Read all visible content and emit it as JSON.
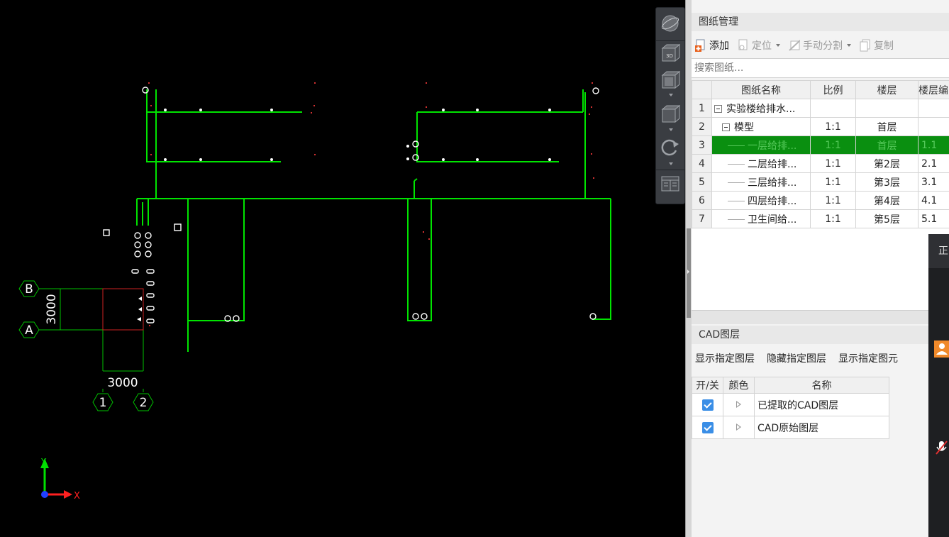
{
  "cad": {
    "axis_labels": {
      "row_b": "B",
      "row_a": "A",
      "col_1": "1",
      "col_2": "2"
    },
    "dims": {
      "horizontal": "3000",
      "vertical": "3000"
    },
    "ucs": {
      "y": "Y",
      "x": "X"
    }
  },
  "nav_toolbar": {
    "buttons": [
      "orbit-icon",
      "view-3d-icon",
      "view-top-icon",
      "view-iso-icon",
      "rotate-icon",
      "layout-icon"
    ],
    "view_3d_label": "3D"
  },
  "drawing_manager": {
    "title": "图纸管理",
    "toolbar": {
      "add": "添加",
      "locate": "定位",
      "manual_split": "手动分割",
      "copy": "复制"
    },
    "search_placeholder": "搜索图纸...",
    "columns": {
      "num": "",
      "name": "图纸名称",
      "scale": "比例",
      "floor": "楼层",
      "floor_code": "楼层编"
    },
    "rows": [
      {
        "num": "1",
        "name": "实验楼给排水...",
        "scale": "",
        "floor": "",
        "code": ""
      },
      {
        "num": "2",
        "name": "模型",
        "scale": "1:1",
        "floor": "首层",
        "code": ""
      },
      {
        "num": "3",
        "name": "一层给排...",
        "scale": "1:1",
        "floor": "首层",
        "code": "1.1"
      },
      {
        "num": "4",
        "name": "二层给排...",
        "scale": "1:1",
        "floor": "第2层",
        "code": "2.1"
      },
      {
        "num": "5",
        "name": "三层给排...",
        "scale": "1:1",
        "floor": "第3层",
        "code": "3.1"
      },
      {
        "num": "6",
        "name": "四层给排...",
        "scale": "1:1",
        "floor": "第4层",
        "code": "4.1"
      },
      {
        "num": "7",
        "name": "卫生间给...",
        "scale": "1:1",
        "floor": "第5层",
        "code": "5.1"
      }
    ]
  },
  "cad_layers": {
    "title": "CAD图层",
    "actions": {
      "show_layer": "显示指定图层",
      "hide_layer": "隐藏指定图层",
      "show_element": "显示指定图元"
    },
    "columns": {
      "toggle": "开/关",
      "color": "颜色",
      "name": "名称"
    },
    "rows": [
      {
        "checked": true,
        "name": "已提取的CAD图层"
      },
      {
        "checked": true,
        "name": "CAD原始图层"
      }
    ]
  },
  "sidebar": {
    "head": "正"
  },
  "colors": {
    "pipe": "#00e400",
    "grid_red": "#cc2222",
    "selected_row": "#0a8f10",
    "check_blue": "#3a8ee6"
  }
}
